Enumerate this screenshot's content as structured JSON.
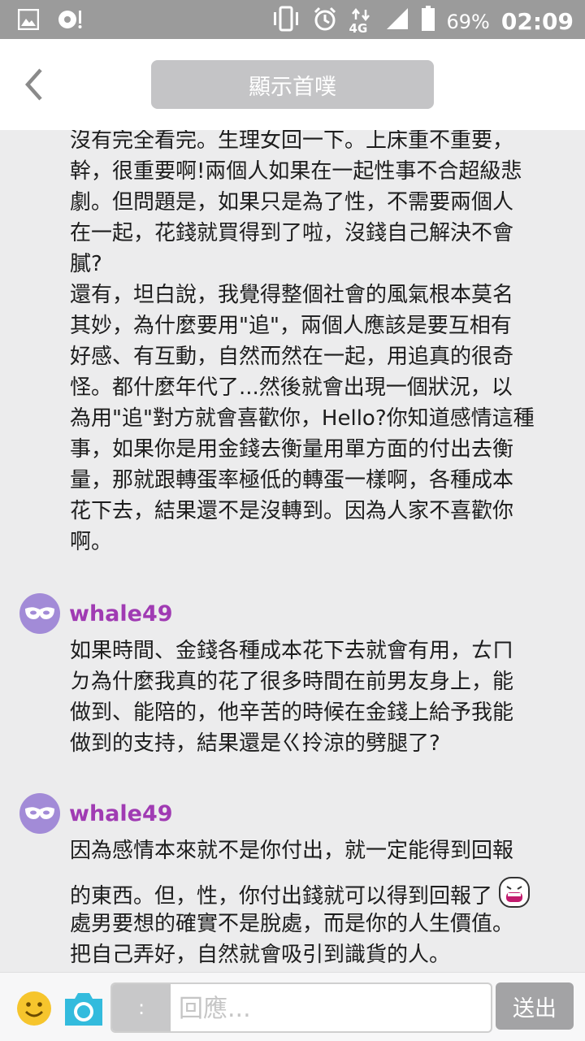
{
  "status_bar": {
    "battery": "69%",
    "time": "02:09",
    "network": "4G",
    "icons": [
      "gallery-icon",
      "media-icon",
      "vibrate-icon",
      "alarm-icon",
      "data-icon",
      "signal-icon",
      "battery-icon"
    ]
  },
  "header": {
    "back_icon": "chevron-left-icon",
    "show_first_button": "顯示首噗"
  },
  "post": {
    "text": "沒有完全看完。生理女回一下。上床重不重要，\n幹，很重要啊!兩個人如果在一起性事不合超級悲\n劇。但問題是，如果只是為了性，不需要兩個人\n在一起，花錢就買得到了啦，沒錢自己解決不會\n膩?\n還有，坦白說，我覺得整個社會的風氣根本莫名\n其妙，為什麼要用\"追\"，兩個人應該是要互相有\n好感、有互動，自然而然在一起，用追真的很奇\n怪。都什麼年代了...然後就會出現一個狀況，以\n為用\"追\"對方就會喜歡你，Hello?你知道感情這種\n事，如果你是用金錢去衡量用單方面的付出去衡\n量，那就跟轉蛋率極低的轉蛋一樣啊，各種成本\n花下去，結果還不是沒轉到。因為人家不喜歡你\n啊。"
  },
  "comments": [
    {
      "author": "whale49",
      "avatar_icon": "mask-icon",
      "text": "如果時間、金錢各種成本花下去就會有用，ㄊㄇ\nㄉ為什麼我真的花了很多時間在前男友身上，能\n做到、能陪的，他辛苦的時候在金錢上給予我能\n做到的支持，結果還是ㄍ拎涼的劈腿了?"
    },
    {
      "author": "whale49",
      "avatar_icon": "mask-icon",
      "line1": "因為感情本來就不是你付出，就一定能得到回報",
      "line2": "的東西。但，性，你付出錢就可以得到回報了",
      "rest": "處男要想的確實不是脫處，而是你的人生價值。\n把自己弄好，自然就會吸引到識貨的人。",
      "emoticon": "laughing-emoticon"
    }
  ],
  "input_bar": {
    "smile_icon": "smile-icon",
    "camera_icon": "camera-icon",
    "prefix": ":",
    "placeholder": "回應...",
    "send_label": "送出"
  },
  "colors": {
    "status_bar": "#9b9b9b",
    "author": "#a03bb3",
    "avatar": "#a28bd7",
    "background": "#ececed"
  }
}
